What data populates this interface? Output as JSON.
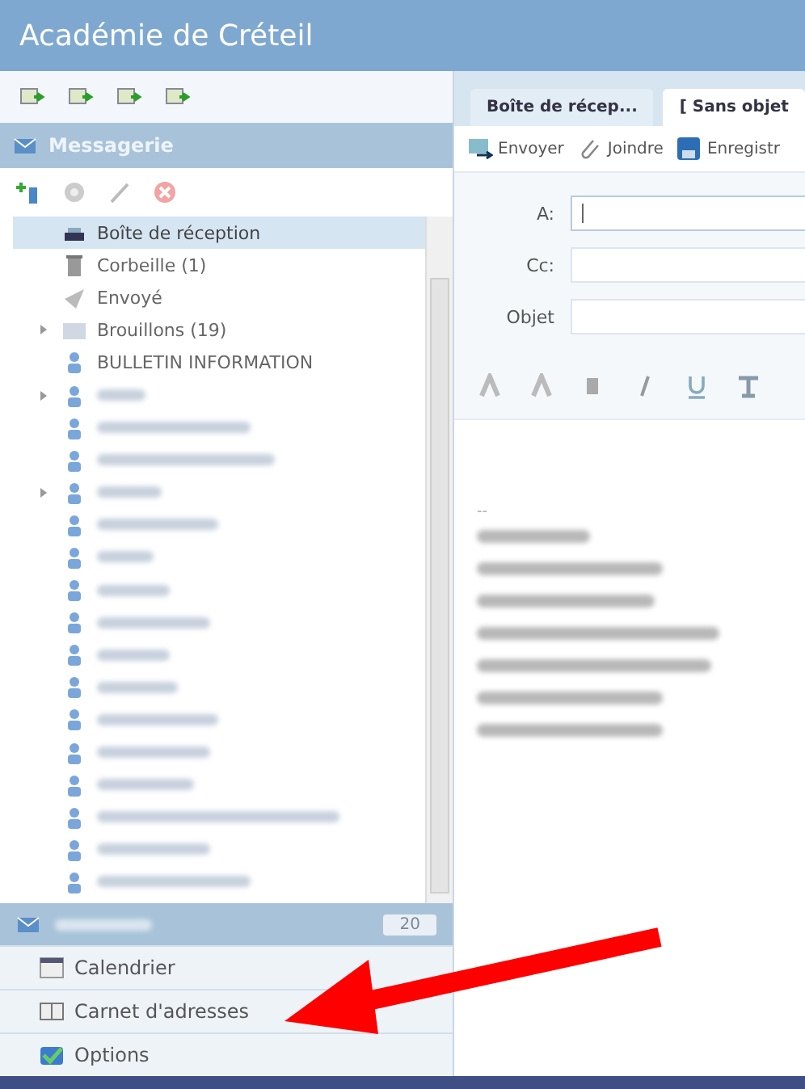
{
  "window": {
    "title": "Académie de Créteil"
  },
  "sidebar": {
    "header": "Messagerie",
    "folders": [
      {
        "kind": "inbox",
        "label": "Boîte de réception",
        "selected": true,
        "expandable": false
      },
      {
        "kind": "trash",
        "label": "Corbeille (1)",
        "selected": false,
        "expandable": false
      },
      {
        "kind": "sent",
        "label": "Envoyé",
        "selected": false,
        "expandable": false
      },
      {
        "kind": "drafts",
        "label": "Brouillons (19)",
        "selected": false,
        "expandable": true
      },
      {
        "kind": "contact",
        "label": "BULLETIN INFORMATION",
        "selected": false,
        "expandable": false
      },
      {
        "kind": "contact",
        "selected": false,
        "expandable": true
      },
      {
        "kind": "contact",
        "selected": false,
        "expandable": false
      },
      {
        "kind": "contact",
        "selected": false,
        "expandable": false
      },
      {
        "kind": "contact",
        "selected": false,
        "expandable": true
      },
      {
        "kind": "contact",
        "selected": false,
        "expandable": false
      },
      {
        "kind": "contact",
        "selected": false,
        "expandable": false
      },
      {
        "kind": "contact",
        "selected": false,
        "expandable": false
      },
      {
        "kind": "contact",
        "selected": false,
        "expandable": false
      },
      {
        "kind": "contact",
        "selected": false,
        "expandable": false
      },
      {
        "kind": "contact",
        "selected": false,
        "expandable": false
      },
      {
        "kind": "contact",
        "selected": false,
        "expandable": false
      },
      {
        "kind": "contact",
        "selected": false,
        "expandable": false
      },
      {
        "kind": "contact",
        "selected": false,
        "expandable": false
      },
      {
        "kind": "contact",
        "selected": false,
        "expandable": false
      },
      {
        "kind": "contact",
        "selected": false,
        "expandable": false
      },
      {
        "kind": "contact",
        "selected": false,
        "expandable": false
      }
    ],
    "nav": [
      {
        "kind": "header",
        "badge": "20"
      },
      {
        "kind": "calendar",
        "label": "Calendrier"
      },
      {
        "kind": "addressbook",
        "label": "Carnet d'adresses"
      },
      {
        "kind": "options",
        "label": "Options"
      }
    ]
  },
  "tabs": [
    {
      "label": "Boîte de récep...",
      "selected": false
    },
    {
      "label": "[ Sans objet",
      "selected": true
    }
  ],
  "toolbar": [
    {
      "label": "Envoyer"
    },
    {
      "label": "Joindre"
    },
    {
      "label": "Enregistr"
    }
  ],
  "fields": [
    {
      "label": "A:",
      "focused": true
    },
    {
      "label": "Cc:",
      "focused": false
    },
    {
      "label": "Objet",
      "focused": false
    }
  ],
  "body": {
    "separator": "--"
  }
}
